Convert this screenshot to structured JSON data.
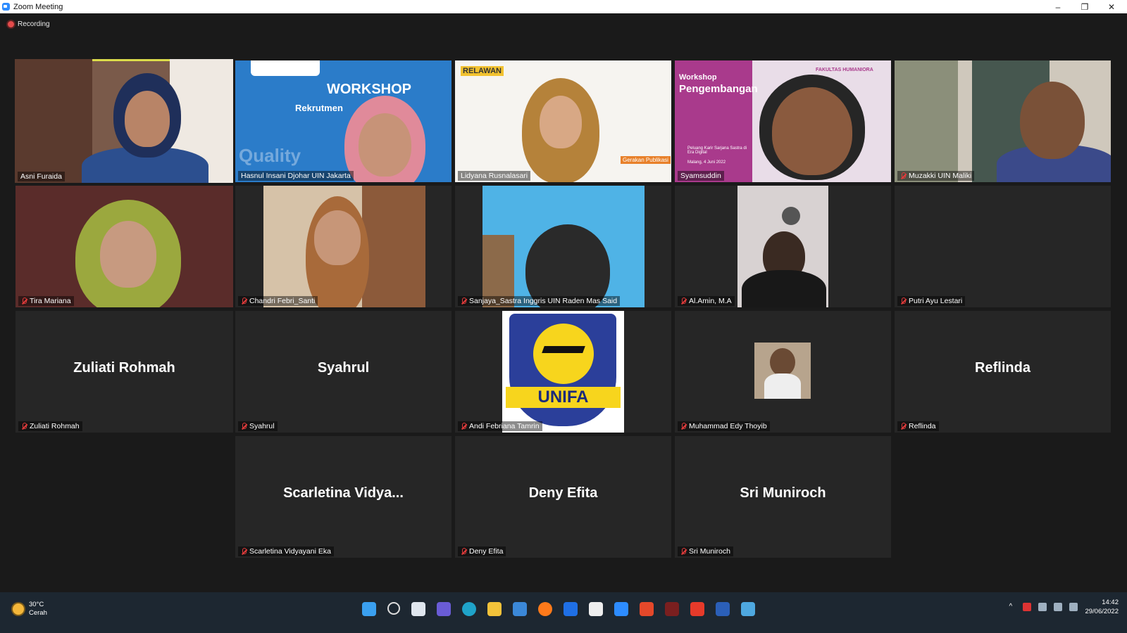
{
  "window": {
    "title": "Zoom Meeting"
  },
  "recording": {
    "label": "Recording"
  },
  "participants": [
    {
      "name": "Asni Furaida",
      "muted": false
    },
    {
      "name": "Hasnul Insani Djohar UIN Jakarta",
      "muted": false
    },
    {
      "name": "Lidyana Rusnalasari",
      "muted": false
    },
    {
      "name": "Syamsuddin",
      "muted": false
    },
    {
      "name": "Muzakki UIN Maliki",
      "muted": true
    },
    {
      "name": "Tira Mariana",
      "muted": true
    },
    {
      "name": "Chandri Febri_Santi",
      "muted": true
    },
    {
      "name": "Sanjaya_Sastra Inggris UIN Raden Mas Said",
      "muted": true
    },
    {
      "name": "Al.Amin, M.A",
      "muted": true
    },
    {
      "name": "Putri Ayu Lestari",
      "muted": true
    },
    {
      "name": "Zuliati Rohmah",
      "muted": true,
      "display": "Zuliati Rohmah"
    },
    {
      "name": "Syahrul",
      "muted": true,
      "display": "Syahrul"
    },
    {
      "name": "Andi Febriana Tamrin",
      "muted": true
    },
    {
      "name": "Muhammad Edy Thoyib",
      "muted": true
    },
    {
      "name": "Reflinda",
      "muted": true,
      "display": "Reflinda"
    },
    {
      "name": "Scarletina Vidyayani Eka",
      "muted": true,
      "display": "Scarletina  Vidya..."
    },
    {
      "name": "Deny Efita",
      "muted": true,
      "display": "Deny Efita"
    },
    {
      "name": "Sri Muniroch",
      "muted": true,
      "display": "Sri Muniroch"
    }
  ],
  "slide_text": {
    "workshop": "WORKSHOP",
    "rekrutmen": "Rekrutmen",
    "quality": "Quality",
    "relawan": "RELAWAN",
    "gerakan": "Gerakan Publikasi",
    "workshop2": "Workshop",
    "pengembangan": "Pengembangan",
    "peluang": "Peluang Karir Sarjana Sastra di Era Digital",
    "malang": "Malang, 4 Juni 2022",
    "humaniora": "FAKULTAS HUMANIORA",
    "unifa": "UNIFA"
  },
  "taskbar": {
    "weather_temp": "30°C",
    "weather_desc": "Cerah",
    "time": "14:42",
    "date": "29/06/2022"
  }
}
